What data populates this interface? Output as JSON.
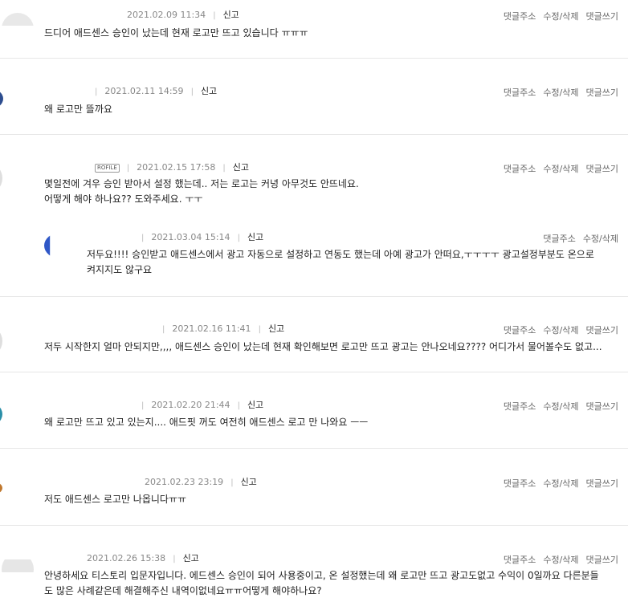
{
  "comments": [
    {
      "date": "2021.02.09 11:34",
      "report": "신고",
      "actions": [
        "댓글주소",
        "수정/삭제",
        "댓글쓰기"
      ],
      "lines": [
        "드디어 애드센스 승인이 났는데 현재 로고만 뜨고 있습니다 ㅠㅠㅠ"
      ]
    },
    {
      "date": "2021.02.11 14:59",
      "report": "신고",
      "actions": [
        "댓글주소",
        "수정/삭제",
        "댓글쓰기"
      ],
      "lines": [
        "왜 로고만 뜰까요"
      ]
    },
    {
      "profile_tag": "ROFILE",
      "date": "2021.02.15 17:58",
      "report": "신고",
      "actions": [
        "댓글주소",
        "수정/삭제",
        "댓글쓰기"
      ],
      "lines": [
        "몇일전에 겨우 승인 받아서 설정 했는데.. 저는 로고는 커녕 아무것도 안뜨네요.",
        "어떻게 해야 하나요?? 도와주세요. ㅜㅜ"
      ]
    },
    {
      "date": "2021.03.04 15:14",
      "report": "신고",
      "actions": [
        "댓글주소",
        "수정/삭제"
      ],
      "lines": [
        "저두요!!!! 승인받고 애드센스에서 광고 자동으로 설정하고 연동도 했는데 아예 광고가 안떠요,ㅜㅜㅜㅜ 광고설정부분도 온으로",
        "켜지지도 않구요"
      ]
    },
    {
      "date": "2021.02.16 11:41",
      "report": "신고",
      "actions": [
        "댓글주소",
        "수정/삭제",
        "댓글쓰기"
      ],
      "lines": [
        "저두 시작한지 얼마 안되지만,,,, 애드센스 승인이 났는데 현재 확인해보면 로고만 뜨고 광고는 안나오네요???? 어디가서 물어볼수도 없고..."
      ]
    },
    {
      "date": "2021.02.20 21:44",
      "report": "신고",
      "actions": [
        "댓글주소",
        "수정/삭제",
        "댓글쓰기"
      ],
      "lines": [
        "왜 로고만 뜨고 있고 있는지.... 애드핏 꺼도 여전히 애드센스 로고 만 나와요 ㅡㅡ"
      ]
    },
    {
      "date": "2021.02.23 23:19",
      "report": "신고",
      "actions": [
        "댓글주소",
        "수정/삭제",
        "댓글쓰기"
      ],
      "lines": [
        "저도 애드센스 로고만 나옵니다ㅠㅠ"
      ]
    },
    {
      "date": "2021.02.26 15:38",
      "report": "신고",
      "actions": [
        "댓글주소",
        "수정/삭제",
        "댓글쓰기"
      ],
      "lines": [
        "안녕하세요 티스토리 입문자입니다. 에드센스 승인이 되어 사용중이고, 온 설정했는데 왜 로고만 뜨고 광고도없고 수익이 0일까요 다른분들",
        "도 많은 사례같은데 해결해주신 내역이없네요ㅠㅠ어떻게 해야하나요?"
      ]
    }
  ]
}
